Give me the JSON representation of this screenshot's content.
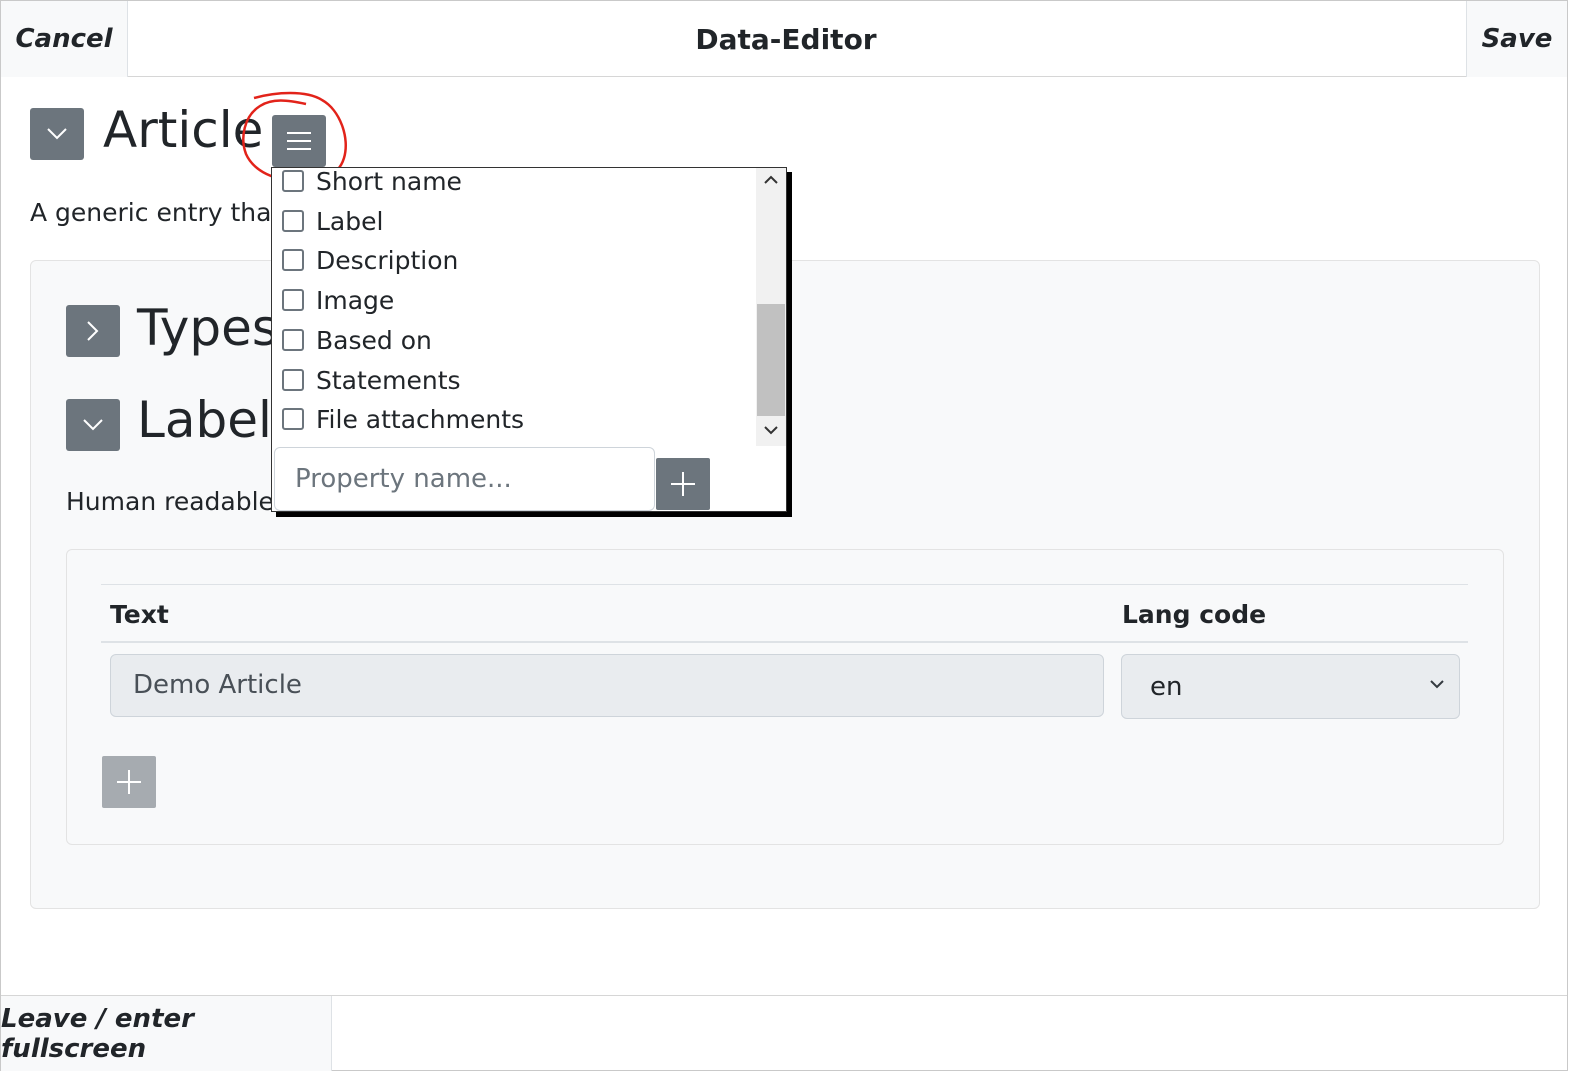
{
  "header": {
    "cancel_label": "Cancel",
    "title": "Data-Editor",
    "save_label": "Save"
  },
  "article": {
    "title": "Article",
    "description": "A generic entry that c",
    "collapse_icon": "chevron-down-icon",
    "menu_icon": "hamburger-menu-icon"
  },
  "sections": {
    "types_title": "Types/",
    "types_icon": "chevron-right-icon",
    "labels_title": "Labels",
    "labels_icon": "chevron-down-icon",
    "labels_description": "Human readable n"
  },
  "labels_table": {
    "columns": [
      "Text",
      "Lang code"
    ],
    "rows": [
      {
        "text": "Demo Article",
        "lang": "en"
      }
    ],
    "add_icon": "plus-icon"
  },
  "property_menu": {
    "items": [
      {
        "label": "Short name",
        "checked": false
      },
      {
        "label": "Label",
        "checked": false
      },
      {
        "label": "Description",
        "checked": false
      },
      {
        "label": "Image",
        "checked": false
      },
      {
        "label": "Based on",
        "checked": false
      },
      {
        "label": "Statements",
        "checked": false
      },
      {
        "label": "File attachments",
        "checked": false
      }
    ],
    "input_placeholder": "Property name...",
    "add_icon": "plus-icon"
  },
  "footer": {
    "fullscreen_label": "Leave / enter fullscreen"
  },
  "colors": {
    "button_gray": "#6c757d",
    "disabled_button": "#a6abb0",
    "card_bg": "#f8f9fa",
    "annotation_red": "#e2231a"
  }
}
